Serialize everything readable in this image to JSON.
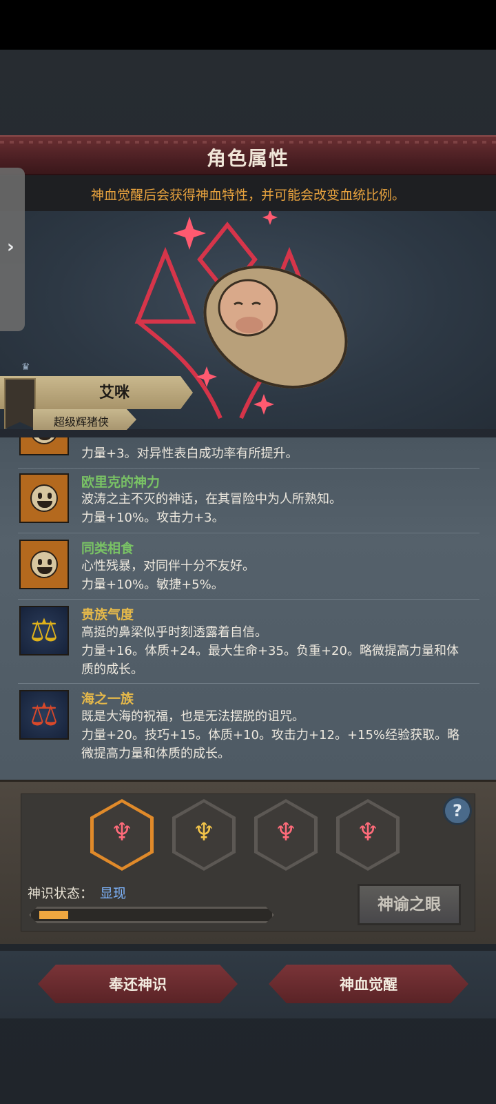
{
  "panel": {
    "title": "角色属性",
    "subtitle": "神血觉醒后会获得神血特性，并可能会改变血统比例。"
  },
  "character": {
    "name": "艾咪",
    "class": "超级辉猪侠"
  },
  "traits": [
    {
      "name": "",
      "icon": "smile-face-icon",
      "name_color": "#79c265",
      "desc": "",
      "effect": "力量+3。对异性表白成功率有所提升。"
    },
    {
      "name": "欧里克的神力",
      "icon": "smile-face-icon",
      "name_color": "#79c265",
      "desc": "波涛之主不灭的神话，在其冒险中为人所熟知。",
      "effect": "力量+10%。攻击力+3。"
    },
    {
      "name": "同类相食",
      "icon": "smile-face-icon",
      "name_color": "#79c265",
      "desc": "心性残暴，对同伴十分不友好。",
      "effect": "力量+10%。敏捷+5%。"
    },
    {
      "name": "贵族气度",
      "icon": "gold-scale-icon",
      "name_color": "#e6b94a",
      "desc": "高挺的鼻梁似乎时刻透露着自信。",
      "effect": "力量+16。体质+24。最大生命+35。负重+20。略微提高力量和体质的成长。"
    },
    {
      "name": "海之一族",
      "icon": "red-scale-icon",
      "name_color": "#e6b94a",
      "desc": "既是大海的祝福，也是无法摆脱的诅咒。",
      "effect": "力量+20。技巧+15。体质+10。攻击力+12。+15%经验获取。略微提高力量和体质的成长。"
    }
  ],
  "awakening": {
    "status_label": "神识状态：",
    "status_value": "显现",
    "progress": 0.13,
    "oracle_button": "神谕之眼",
    "slots": [
      {
        "icon": "red-sigil-icon",
        "color": "#ff6b7a",
        "selected": true
      },
      {
        "icon": "gold-sigil-icon",
        "color": "#f2c44a",
        "selected": false
      },
      {
        "icon": "red-sigil-icon",
        "color": "#ff6b7a",
        "selected": false
      },
      {
        "icon": "red-sigil-icon",
        "color": "#ff6b7a",
        "selected": false
      }
    ]
  },
  "footer": {
    "return_button": "奉还神识",
    "awaken_button": "神血觉醒"
  },
  "colors": {
    "accent_orange": "#e7a23e",
    "status_blue": "#7fb6ff",
    "banner_red": "#5a2326"
  }
}
